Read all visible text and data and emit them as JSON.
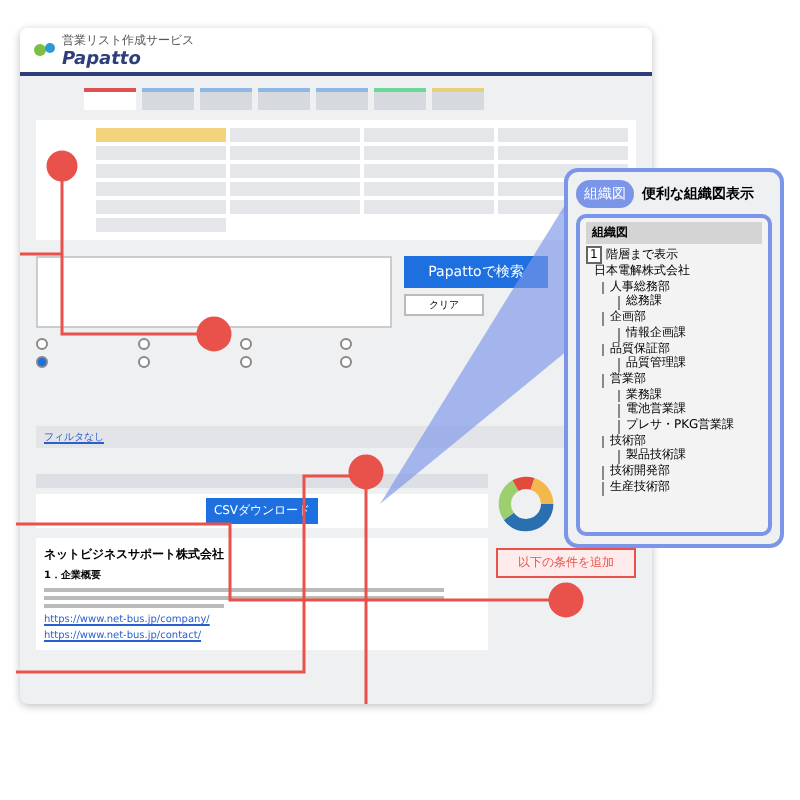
{
  "header": {
    "tagline": "営業リスト作成サービス",
    "logo": "Papatto"
  },
  "tabs": [
    {
      "color": "#e05252",
      "selected": true
    },
    {
      "color": "#8fb8e6",
      "selected": false
    },
    {
      "color": "#8fb8e6",
      "selected": false
    },
    {
      "color": "#8fb8e6",
      "selected": false
    },
    {
      "color": "#8fb8e6",
      "selected": false
    },
    {
      "color": "#6fd69a",
      "selected": false
    },
    {
      "color": "#e6d27a",
      "selected": false
    }
  ],
  "tiles": [
    {
      "selected": true
    },
    {
      "selected": false
    },
    {
      "selected": false
    },
    {
      "selected": false
    },
    {
      "selected": false
    },
    {
      "selected": false
    },
    {
      "selected": false
    },
    {
      "selected": false
    },
    {
      "selected": false
    },
    {
      "selected": false
    },
    {
      "selected": false
    },
    {
      "selected": false
    },
    {
      "selected": false
    },
    {
      "selected": false
    },
    {
      "selected": false
    },
    {
      "selected": false
    },
    {
      "selected": false
    },
    {
      "selected": false
    },
    {
      "selected": false
    },
    {
      "selected": false
    },
    {
      "selected": false
    }
  ],
  "search": {
    "button": "Papattoで検索",
    "clear": "クリア"
  },
  "filter_link": "フィルタなし",
  "download": {
    "button": "CSVダウンロード"
  },
  "company": {
    "name": "ネットビジネスサポート株式会社",
    "section": "1．企業概要",
    "urls": [
      "https://www.net-bus.jp/company/",
      "https://www.net-bus.jp/contact/"
    ]
  },
  "add_condition": "以下の条件を追加",
  "org_panel": {
    "pill": "組織図",
    "title": "便利な組織図表示",
    "header": "組織図",
    "depth": "1",
    "depth_label": "階層まで表示",
    "tree": [
      {
        "label": "日本電解株式会社",
        "children": [
          {
            "label": "人事総務部",
            "children": [
              {
                "label": "総務課"
              }
            ]
          },
          {
            "label": "企画部",
            "children": [
              {
                "label": "情報企画課"
              }
            ]
          },
          {
            "label": "品質保証部",
            "children": [
              {
                "label": "品質管理課"
              }
            ]
          },
          {
            "label": "営業部",
            "children": [
              {
                "label": "業務課"
              },
              {
                "label": "電池営業課"
              },
              {
                "label": "プレサ・PKG営業課"
              }
            ]
          },
          {
            "label": "技術部",
            "children": [
              {
                "label": "製品技術課"
              }
            ]
          },
          {
            "label": "技術開発部"
          },
          {
            "label": "生産技術部"
          }
        ]
      }
    ]
  }
}
